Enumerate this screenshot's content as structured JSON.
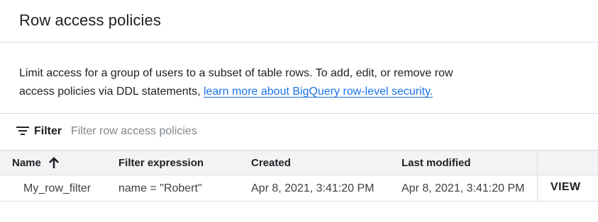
{
  "header": {
    "title": "Row access policies"
  },
  "description": {
    "text": "Limit access for a group of users to a subset of table rows. To add, edit, or remove row access policies via DDL statements, ",
    "link_text": "learn more about BigQuery row-level security."
  },
  "filter": {
    "label": "Filter",
    "placeholder": "Filter row access policies",
    "icon": "filter-list-icon"
  },
  "table": {
    "columns": [
      {
        "label": "Name",
        "sort": "ascending",
        "sort_icon": "arrow-upward-icon"
      },
      {
        "label": "Filter expression"
      },
      {
        "label": "Created"
      },
      {
        "label": "Last modified"
      }
    ],
    "rows": [
      {
        "name": "My_row_filter",
        "filter_expression": "name = \"Robert\"",
        "created": "Apr 8, 2021, 3:41:20 PM",
        "last_modified": "Apr 8, 2021, 3:41:20 PM",
        "action": "VIEW"
      }
    ]
  },
  "colors": {
    "text": "#202124",
    "link": "#1a73e8",
    "border": "#dadce0",
    "header_bg": "#f1f3f4",
    "placeholder": "#80868b"
  }
}
